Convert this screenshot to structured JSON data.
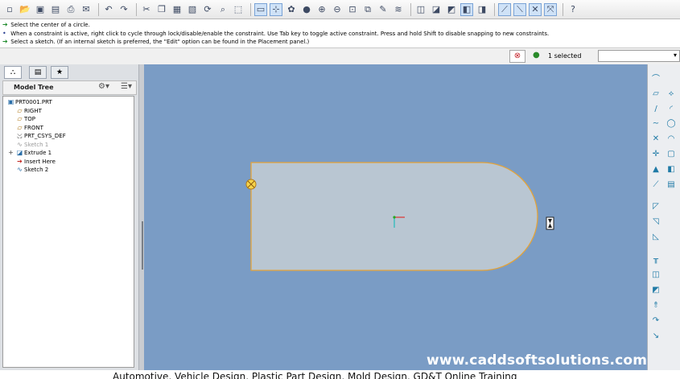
{
  "toolbar": {
    "icons": [
      "new",
      "open",
      "save",
      "save-as",
      "print",
      "email",
      "undo",
      "redo",
      "cut",
      "copy",
      "paste",
      "paste-special",
      "regenerate",
      "find",
      "select",
      "model-player",
      "sketch",
      "constraints",
      "zoom-in",
      "zoom-out",
      "refit",
      "named-views",
      "repaint",
      "layers",
      "datum-planes",
      "datum-axes",
      "datum-points",
      "csys",
      "annotations",
      "help"
    ]
  },
  "messages": [
    "Select the center of a circle.",
    "When a constraint is active, right click to cycle through lock/disable/enable the constraint. Use Tab key to toggle active constraint. Press and hold Shift to disable snapping to new constraints.",
    "Select a sketch. (If an internal sketch is preferred, the \"Edit\" option can be found in the Placement panel.)"
  ],
  "status": {
    "selected_text": "1 selected",
    "filter_value": ""
  },
  "model_tree": {
    "title": "Model Tree",
    "items": [
      {
        "label": "PRT0001.PRT",
        "icon": "part-icon"
      },
      {
        "label": "RIGHT",
        "icon": "datum-plane-icon"
      },
      {
        "label": "TOP",
        "icon": "datum-plane-icon"
      },
      {
        "label": "FRONT",
        "icon": "datum-plane-icon"
      },
      {
        "label": "PRT_CSYS_DEF",
        "icon": "csys-icon"
      },
      {
        "label": "Sketch 1",
        "icon": "sketch-icon"
      },
      {
        "label": "Extrude 1",
        "icon": "extrude-icon"
      },
      {
        "label": "Insert Here",
        "icon": "insert-arrow-icon"
      },
      {
        "label": "Sketch 2",
        "icon": "sketch-icon"
      }
    ]
  },
  "watermark": "www.caddsoftsolutions.com",
  "footer_text": "Automotive, Vehicle Design, Plastic Part Design, Mold Design, GD&T Online Training",
  "colors": {
    "canvas_bg": "#7a9cc5",
    "sketch_fill": "#b9c6d2",
    "sketch_edge": "#e3a33a"
  }
}
